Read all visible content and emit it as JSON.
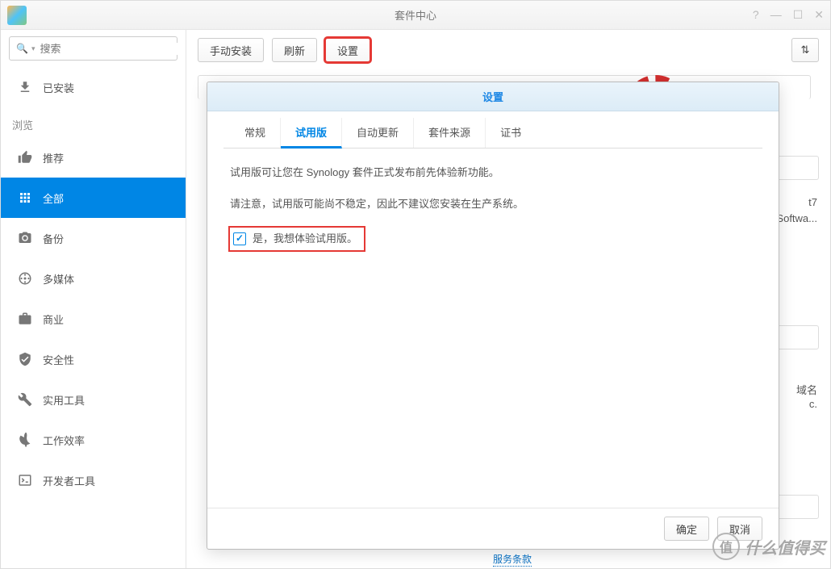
{
  "window": {
    "title": "套件中心"
  },
  "search": {
    "placeholder": "搜索"
  },
  "sidebar": {
    "installed": "已安装",
    "browse_label": "浏览",
    "items": [
      {
        "label": "推荐"
      },
      {
        "label": "全部"
      },
      {
        "label": "备份"
      },
      {
        "label": "多媒体"
      },
      {
        "label": "商业"
      },
      {
        "label": "安全性"
      },
      {
        "label": "实用工具"
      },
      {
        "label": "工作效率"
      },
      {
        "label": "开发者工具"
      }
    ]
  },
  "toolbar": {
    "manual_install": "手动安装",
    "refresh": "刷新",
    "settings": "设置"
  },
  "modal": {
    "title": "设置",
    "tabs": {
      "general": "常规",
      "trial": "试用版",
      "auto_update": "自动更新",
      "source": "套件来源",
      "cert": "证书"
    },
    "body": {
      "line1": "试用版可让您在 Synology 套件正式发布前先体验新功能。",
      "line2": "请注意，试用版可能尚不稳定，因此不建议您安装在生产系统。",
      "checkbox_label": "是，我想体验试用版。"
    },
    "footer": {
      "ok": "确定",
      "cancel": "取消"
    }
  },
  "peek": {
    "card1_line1": "t7",
    "card1_line2": "Softwa...",
    "card2_line1": "域名",
    "card2_line2": "c."
  },
  "footer_link": "服务条款",
  "watermark": "什么值得买"
}
